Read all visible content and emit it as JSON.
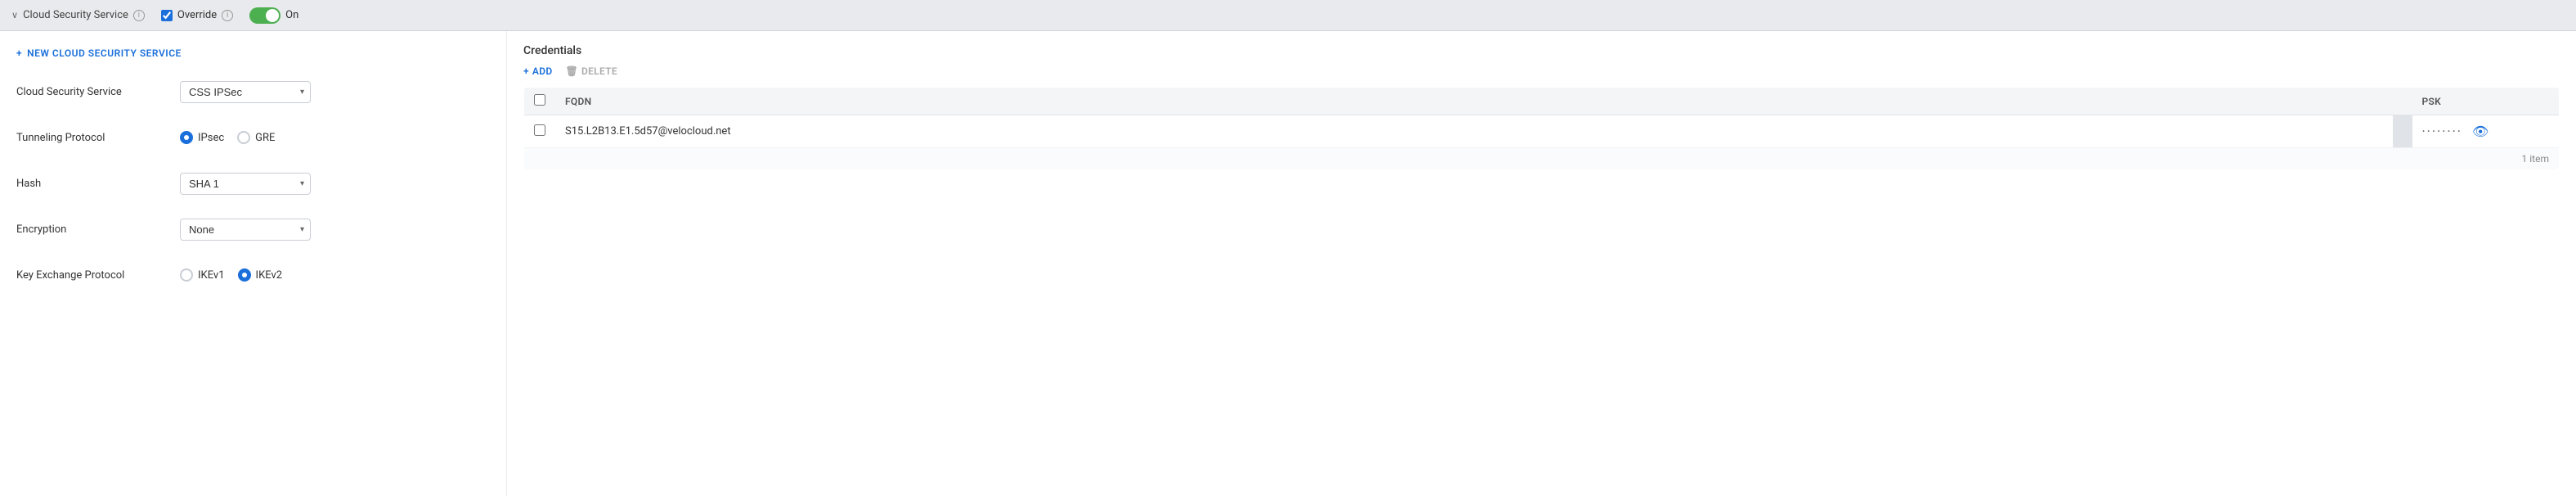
{
  "topbar": {
    "service_name": "Cloud Security Service",
    "override_label": "Override",
    "toggle_label": "On"
  },
  "left_panel": {
    "new_service_btn": "NEW CLOUD SECURITY SERVICE",
    "fields": {
      "cloud_security_service": {
        "label": "Cloud Security Service",
        "value": "CSS IPSec"
      },
      "tunneling_protocol": {
        "label": "Tunneling Protocol",
        "option1": "IPsec",
        "option2": "GRE"
      },
      "hash": {
        "label": "Hash",
        "value": "SHA 1"
      },
      "encryption": {
        "label": "Encryption",
        "value": "None"
      },
      "key_exchange_protocol": {
        "label": "Key Exchange Protocol",
        "option1": "IKEv1",
        "option2": "IKEv2"
      }
    }
  },
  "right_panel": {
    "credentials_title": "Credentials",
    "add_btn": "ADD",
    "delete_btn": "DELETE",
    "table": {
      "col_checkbox": "",
      "col_fqdn": "FQDN",
      "col_psk": "PSK",
      "rows": [
        {
          "fqdn": "S15.L2B13.E1.5d57@velocloud.net",
          "psk": "········"
        }
      ],
      "item_count": "1 item"
    }
  },
  "icons": {
    "plus": "+",
    "trash": "🗑",
    "eye": "👁",
    "info": "i",
    "chevron_down": "▾",
    "chevron_left": "❯"
  }
}
